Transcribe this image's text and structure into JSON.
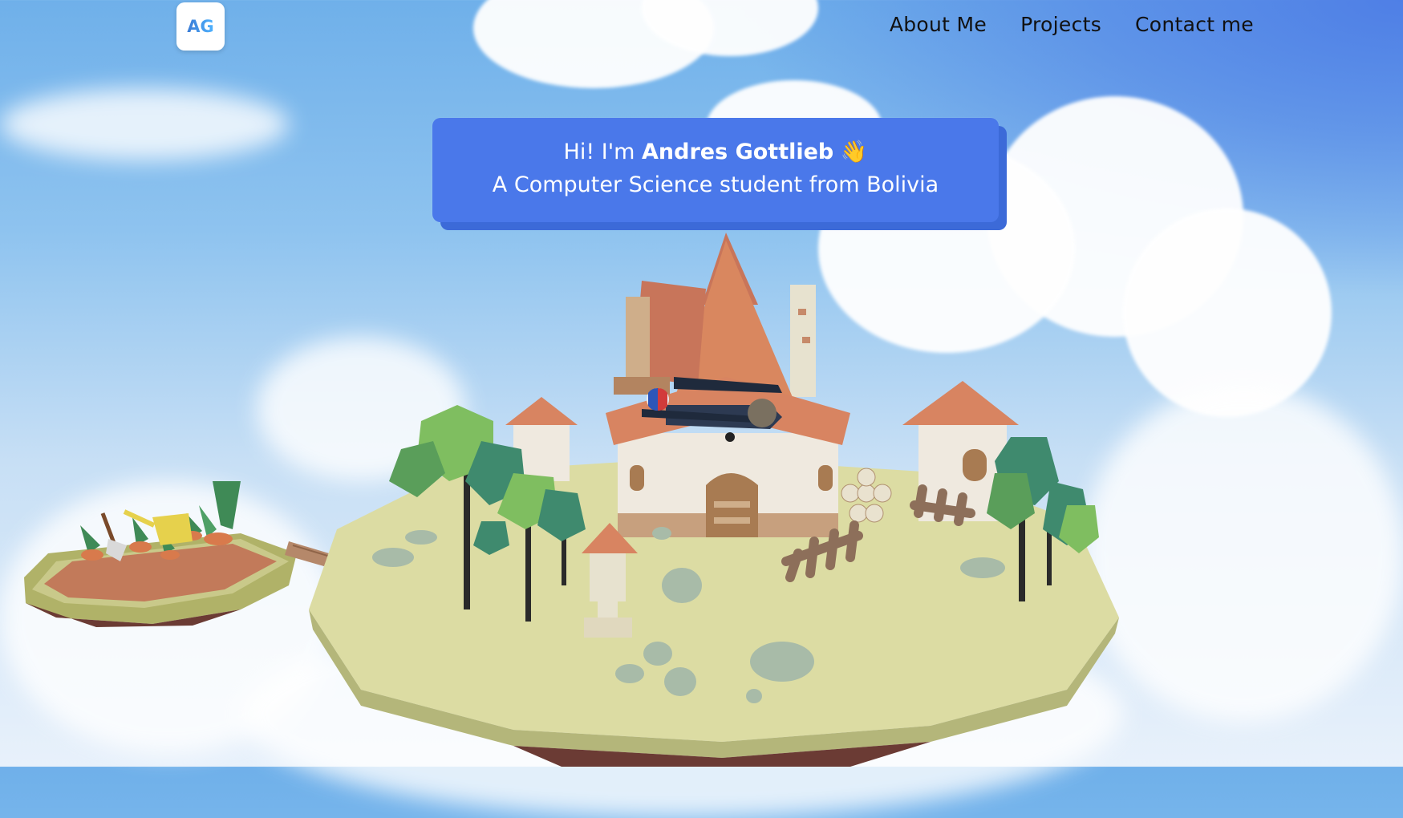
{
  "header": {
    "logo_text": "AG",
    "nav": [
      {
        "label": "About Me"
      },
      {
        "label": "Projects"
      },
      {
        "label": "Contact me"
      }
    ]
  },
  "hero": {
    "greeting": "Hi! I'm",
    "name": "Andres Gottlieb",
    "wave_emoji": "👋",
    "subtitle": "A Computer Science student from Bolivia"
  },
  "colors": {
    "accent": "#4a78ea",
    "sky": "#8ec3ef"
  }
}
